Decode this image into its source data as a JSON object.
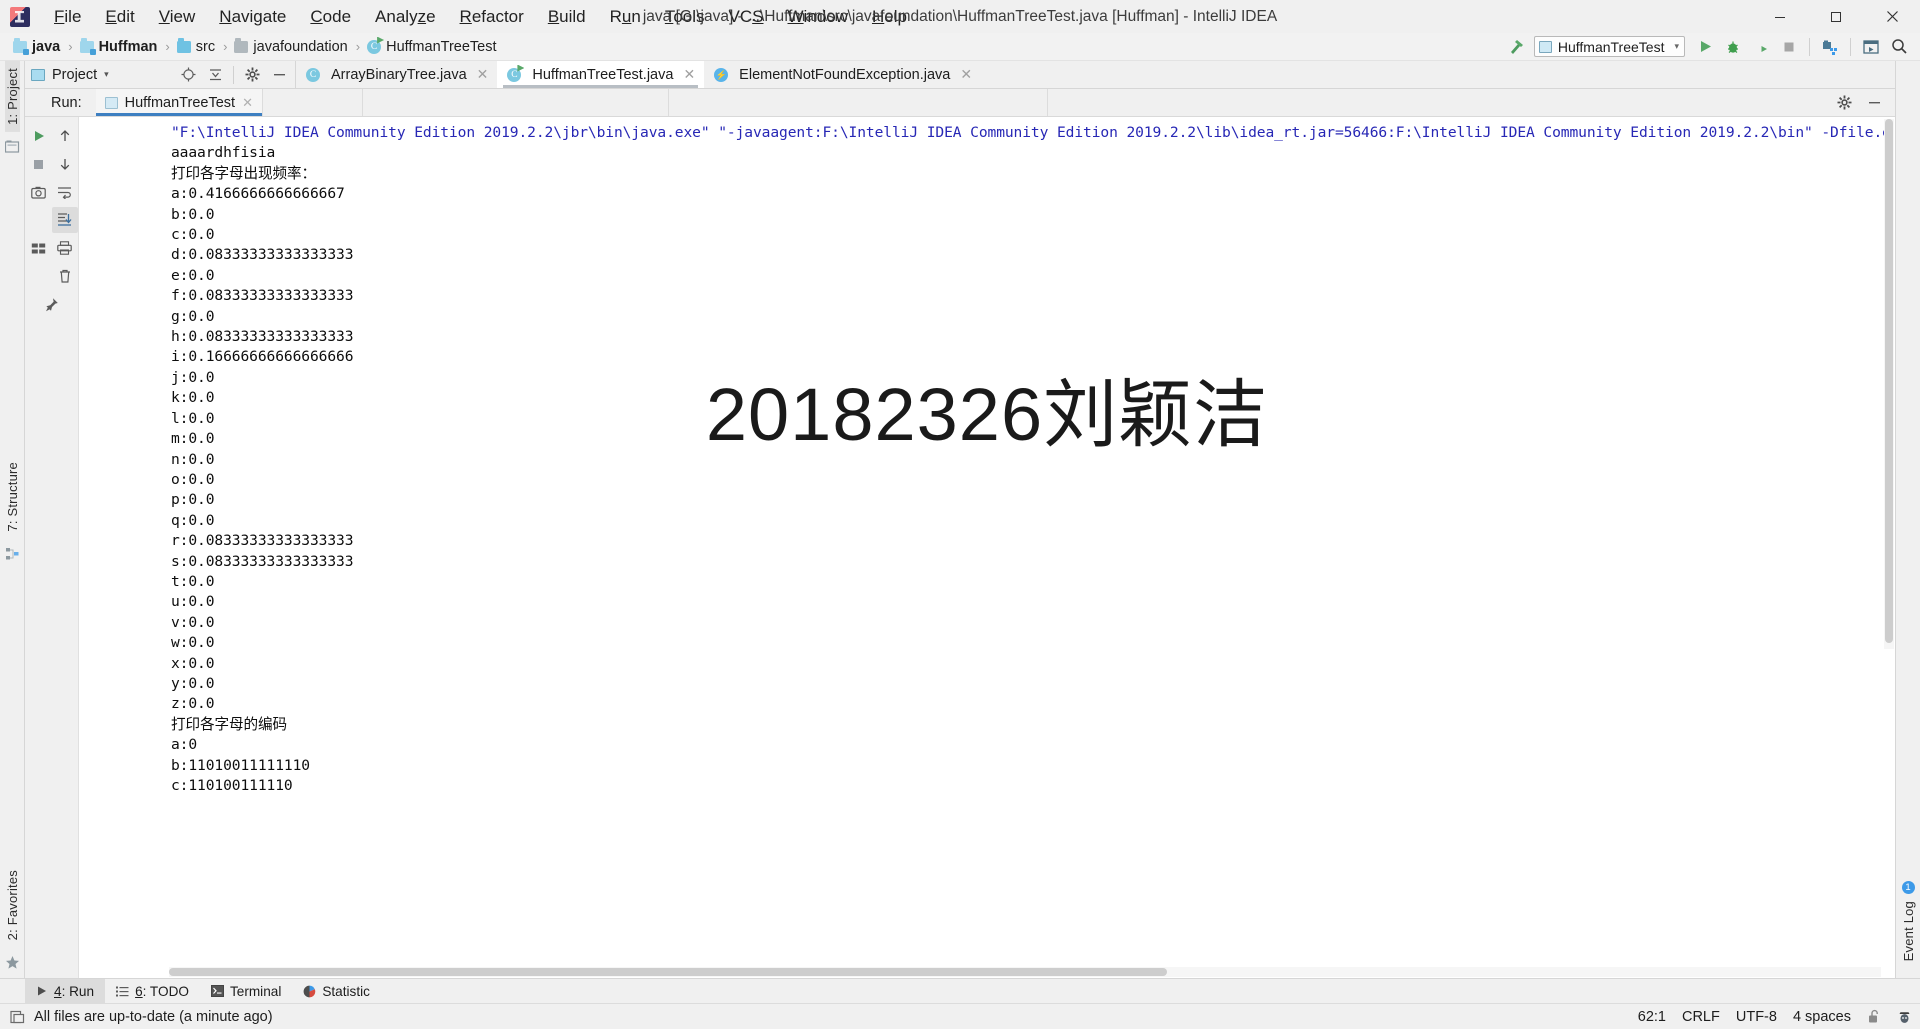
{
  "window": {
    "title": "java [G:\\java] - ...\\Huffman\\src\\javafoundation\\HuffmanTreeTest.java [Huffman] - IntelliJ IDEA",
    "minimize_label": "—",
    "maximize_label": "❐",
    "close_label": "✕",
    "logo_icon": "intellij-logo-icon"
  },
  "menubar": {
    "items": [
      {
        "label": "File",
        "mnemonic": "F"
      },
      {
        "label": "Edit",
        "mnemonic": "E"
      },
      {
        "label": "View",
        "mnemonic": "V"
      },
      {
        "label": "Navigate",
        "mnemonic": "N"
      },
      {
        "label": "Code",
        "mnemonic": "C"
      },
      {
        "label": "Analyze",
        "mnemonic": "z"
      },
      {
        "label": "Refactor",
        "mnemonic": "R"
      },
      {
        "label": "Build",
        "mnemonic": "B"
      },
      {
        "label": "Run",
        "mnemonic": "u"
      },
      {
        "label": "Tools",
        "mnemonic": "T"
      },
      {
        "label": "VCS",
        "mnemonic": "S"
      },
      {
        "label": "Window",
        "mnemonic": "W"
      },
      {
        "label": "Help",
        "mnemonic": "H"
      }
    ]
  },
  "breadcrumb": {
    "items": [
      {
        "label": "java",
        "icon": "module-folder-icon",
        "bold": false
      },
      {
        "label": "Huffman",
        "icon": "module-folder-icon",
        "bold": true
      },
      {
        "label": "src",
        "icon": "source-folder-icon",
        "bold": false
      },
      {
        "label": "javafoundation",
        "icon": "package-folder-icon",
        "bold": false
      },
      {
        "label": "HuffmanTreeTest",
        "icon": "java-class-icon",
        "bold": false
      }
    ],
    "separator": "›"
  },
  "toolbar": {
    "build_icon": "hammer-icon",
    "run_configuration": {
      "label": "HuffmanTreeTest",
      "icon": "run-config-icon",
      "caret": "▾"
    },
    "buttons": [
      {
        "name": "run-button",
        "icon": "play-icon",
        "color": "#59a869"
      },
      {
        "name": "debug-button",
        "icon": "bug-icon",
        "color": "#3f9e4d"
      },
      {
        "name": "run-with-coverage-button",
        "icon": "coverage-icon",
        "color": "#3d3d3d"
      },
      {
        "name": "stop-button",
        "icon": "stop-icon",
        "color": "#9aa0a6"
      },
      {
        "name": "project-structure-button",
        "icon": "project-structure-icon",
        "color": "#4a90c4"
      },
      {
        "name": "updates-button",
        "icon": "window-icon",
        "color": "#4a6d80"
      },
      {
        "name": "search-everywhere-button",
        "icon": "search-icon",
        "color": "#3c3c3c"
      }
    ]
  },
  "project_panel": {
    "label": "Project",
    "caret": "▾",
    "icon": "project-panel-icon",
    "tools": [
      {
        "name": "locate-button",
        "icon": "crosshair-icon"
      },
      {
        "name": "collapse-all-button",
        "icon": "collapse-all-icon"
      },
      {
        "name": "settings-button",
        "icon": "gear-icon"
      },
      {
        "name": "hide-button",
        "icon": "minus-icon"
      }
    ]
  },
  "editor_tabs": [
    {
      "label": "ArrayBinaryTree.java",
      "icon": "java-class-icon",
      "active": false,
      "close": "✕"
    },
    {
      "label": "HuffmanTreeTest.java",
      "icon": "java-runnable-class-icon",
      "active": true,
      "close": "✕"
    },
    {
      "label": "ElementNotFoundException.java",
      "icon": "java-exception-icon",
      "active": false,
      "close": "✕"
    }
  ],
  "left_stripe": {
    "tabs": [
      {
        "label": "1: Project",
        "selected": true,
        "name": "sidebar-tab-project"
      },
      {
        "label": "7: Structure",
        "selected": false,
        "name": "sidebar-tab-structure"
      },
      {
        "label": "2: Favorites",
        "selected": false,
        "name": "sidebar-tab-favorites"
      }
    ],
    "icons": [
      {
        "name": "project-files-icon"
      },
      {
        "name": "structure-nodes-icon"
      },
      {
        "name": "favorites-star-icon"
      }
    ]
  },
  "right_stripe": {
    "badge": "1",
    "label": "Event Log"
  },
  "run_window": {
    "prefix_label": "Run:",
    "tab": {
      "label": "HuffmanTreeTest",
      "icon": "run-tab-icon",
      "close": "✕"
    },
    "header_buttons": [
      {
        "name": "settings-button",
        "icon": "gear-icon"
      },
      {
        "name": "hide-button",
        "icon": "minus-icon"
      }
    ],
    "gutter_buttons": [
      {
        "name": "rerun-button",
        "icon": "rerun-play-icon",
        "selected": false
      },
      {
        "name": "up-stack-button",
        "icon": "arrow-up-icon",
        "selected": false
      },
      {
        "name": "stop-button",
        "icon": "stop-square-icon",
        "selected": false
      },
      {
        "name": "down-stack-button",
        "icon": "arrow-down-icon",
        "selected": false
      },
      {
        "name": "screenshot-button",
        "icon": "camera-icon",
        "selected": false
      },
      {
        "name": "soft-wrap-button",
        "icon": "soft-wrap-icon",
        "selected": false
      },
      {
        "name": "scroll-to-end-button",
        "icon": "scroll-to-end-icon",
        "selected": true
      },
      {
        "name": "print-button",
        "icon": "printer-icon",
        "selected": false
      },
      {
        "name": "show-as-tree-button",
        "icon": "grid-icon",
        "selected": false
      },
      {
        "name": "clear-all-button",
        "icon": "trash-icon",
        "selected": false
      },
      {
        "name": "pin-tab-button",
        "icon": "pin-icon",
        "selected": false
      }
    ]
  },
  "console": {
    "watermark": "20182326刘颖洁",
    "command_line": "\"F:\\IntelliJ IDEA Community Edition 2019.2.2\\jbr\\bin\\java.exe\" \"-javaagent:F:\\IntelliJ IDEA Community Edition 2019.2.2\\lib\\idea_rt.jar=56466:F:\\IntelliJ IDEA Community Edition 2019.2.2\\bin\" -Dfile.e",
    "lines": [
      "aaaardhfisia",
      "打印各字母出现频率：",
      "a:0.4166666666666667",
      "b:0.0",
      "c:0.0",
      "d:0.08333333333333333",
      "e:0.0",
      "f:0.08333333333333333",
      "g:0.0",
      "h:0.08333333333333333",
      "i:0.16666666666666666",
      "j:0.0",
      "k:0.0",
      "l:0.0",
      "m:0.0",
      "n:0.0",
      "o:0.0",
      "p:0.0",
      "q:0.0",
      "r:0.08333333333333333",
      "s:0.08333333333333333",
      "t:0.0",
      "u:0.0",
      "v:0.0",
      "w:0.0",
      "x:0.0",
      "y:0.0",
      "z:0.0",
      "打印各字母的编码",
      "a:0",
      "b:11010011111110",
      "c:110100111110"
    ]
  },
  "bottom_tabs": [
    {
      "label": "4: Run",
      "mnemonic": "4",
      "rest": ": Run",
      "icon": "play-icon",
      "selected": true,
      "name": "bottom-tab-run"
    },
    {
      "label": "6: TODO",
      "mnemonic": "6",
      "rest": ": TODO",
      "icon": "todo-list-icon",
      "selected": false,
      "name": "bottom-tab-todo"
    },
    {
      "label": "Terminal",
      "mnemonic": "",
      "rest": "Terminal",
      "icon": "terminal-icon",
      "selected": false,
      "name": "bottom-tab-terminal"
    },
    {
      "label": "Statistic",
      "mnemonic": "",
      "rest": "Statistic",
      "icon": "statistic-icon",
      "selected": false,
      "name": "bottom-tab-statistic"
    }
  ],
  "statusbar": {
    "message": "All files are up-to-date (a minute ago)",
    "message_icon": "file-sync-icon",
    "caret_position": "62:1",
    "line_separator": "CRLF",
    "encoding": "UTF-8",
    "indent": "4 spaces",
    "lock_icon": "unlocked-padlock-icon",
    "inspector_icon": "hector-inspector-icon"
  }
}
